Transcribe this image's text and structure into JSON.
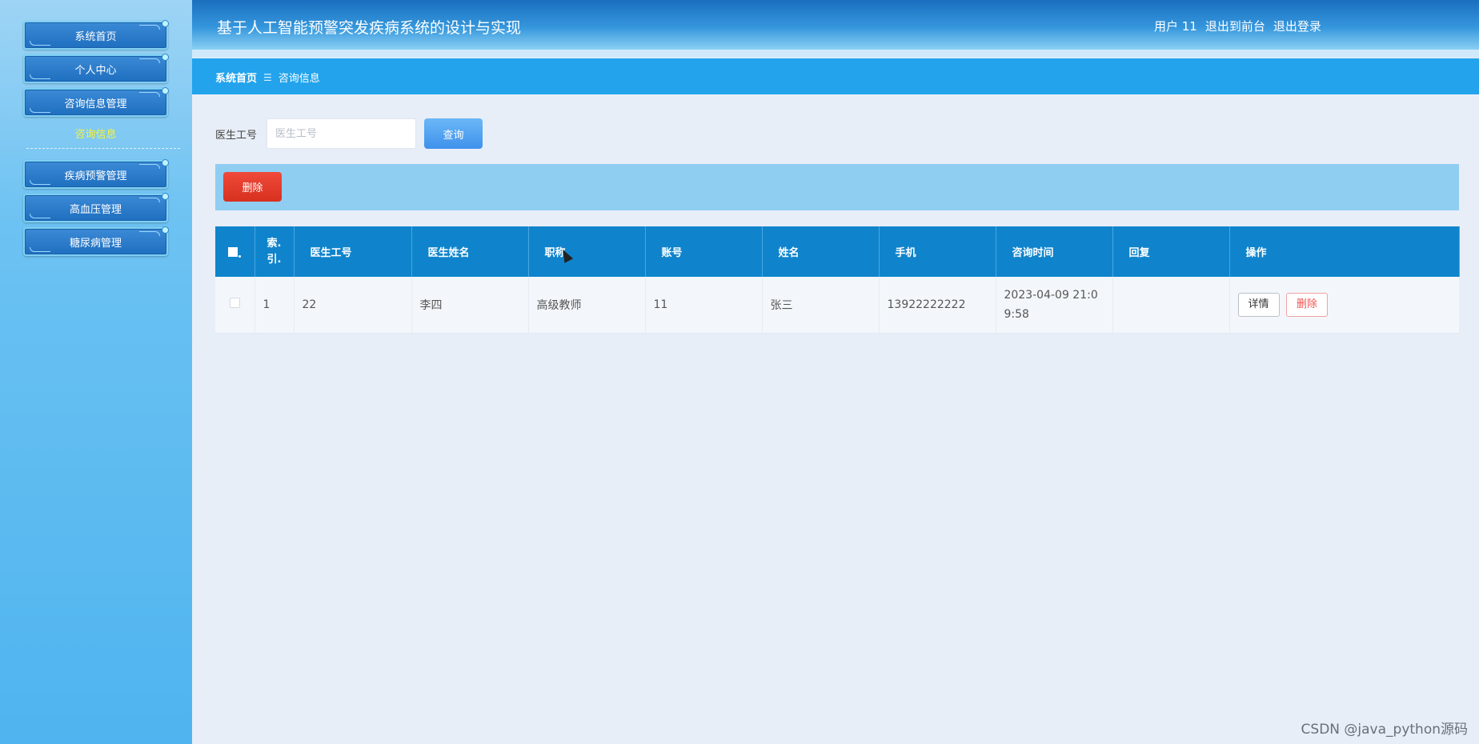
{
  "sidebar": {
    "menu": [
      {
        "label": "系统首页"
      },
      {
        "label": "个人中心"
      },
      {
        "label": "咨询信息管理"
      },
      {
        "label": "疾病预警管理"
      },
      {
        "label": "高血压管理"
      },
      {
        "label": "糖尿病管理"
      }
    ],
    "submenu_active": "咨询信息"
  },
  "header": {
    "title": "基于人工智能预警突发疾病系统的设计与实现",
    "user": "用户 11",
    "to_front": "退出到前台",
    "logout": "退出登录"
  },
  "breadcrumb": {
    "home": "系统首页",
    "separator": "☰",
    "current": "咨询信息"
  },
  "search": {
    "label": "医生工号",
    "placeholder": "医生工号",
    "button": "查询"
  },
  "actions": {
    "delete": "删除"
  },
  "table": {
    "columns": [
      "索引",
      "医生工号",
      "医生姓名",
      "职称",
      "账号",
      "姓名",
      "手机",
      "咨询时间",
      "回复",
      "操作"
    ],
    "index_header_line1": "索.",
    "index_header_line2": "引.",
    "rows": [
      {
        "index": "1",
        "doctor_id": "22",
        "doctor_name": "李四",
        "title": "高级教师",
        "account": "11",
        "name": "张三",
        "phone": "13922222222",
        "time": "2023-04-09 21:09:58",
        "reply": "",
        "detail_btn": "详情",
        "delete_btn": "删除"
      }
    ]
  },
  "watermark": "CSDN @java_python源码",
  "colors": {
    "header": "#1a6fbf",
    "crumb_bar": "#22a3ec",
    "table_header": "#0f84cc",
    "delete": "#d7301f",
    "search": "#3f92ec"
  }
}
